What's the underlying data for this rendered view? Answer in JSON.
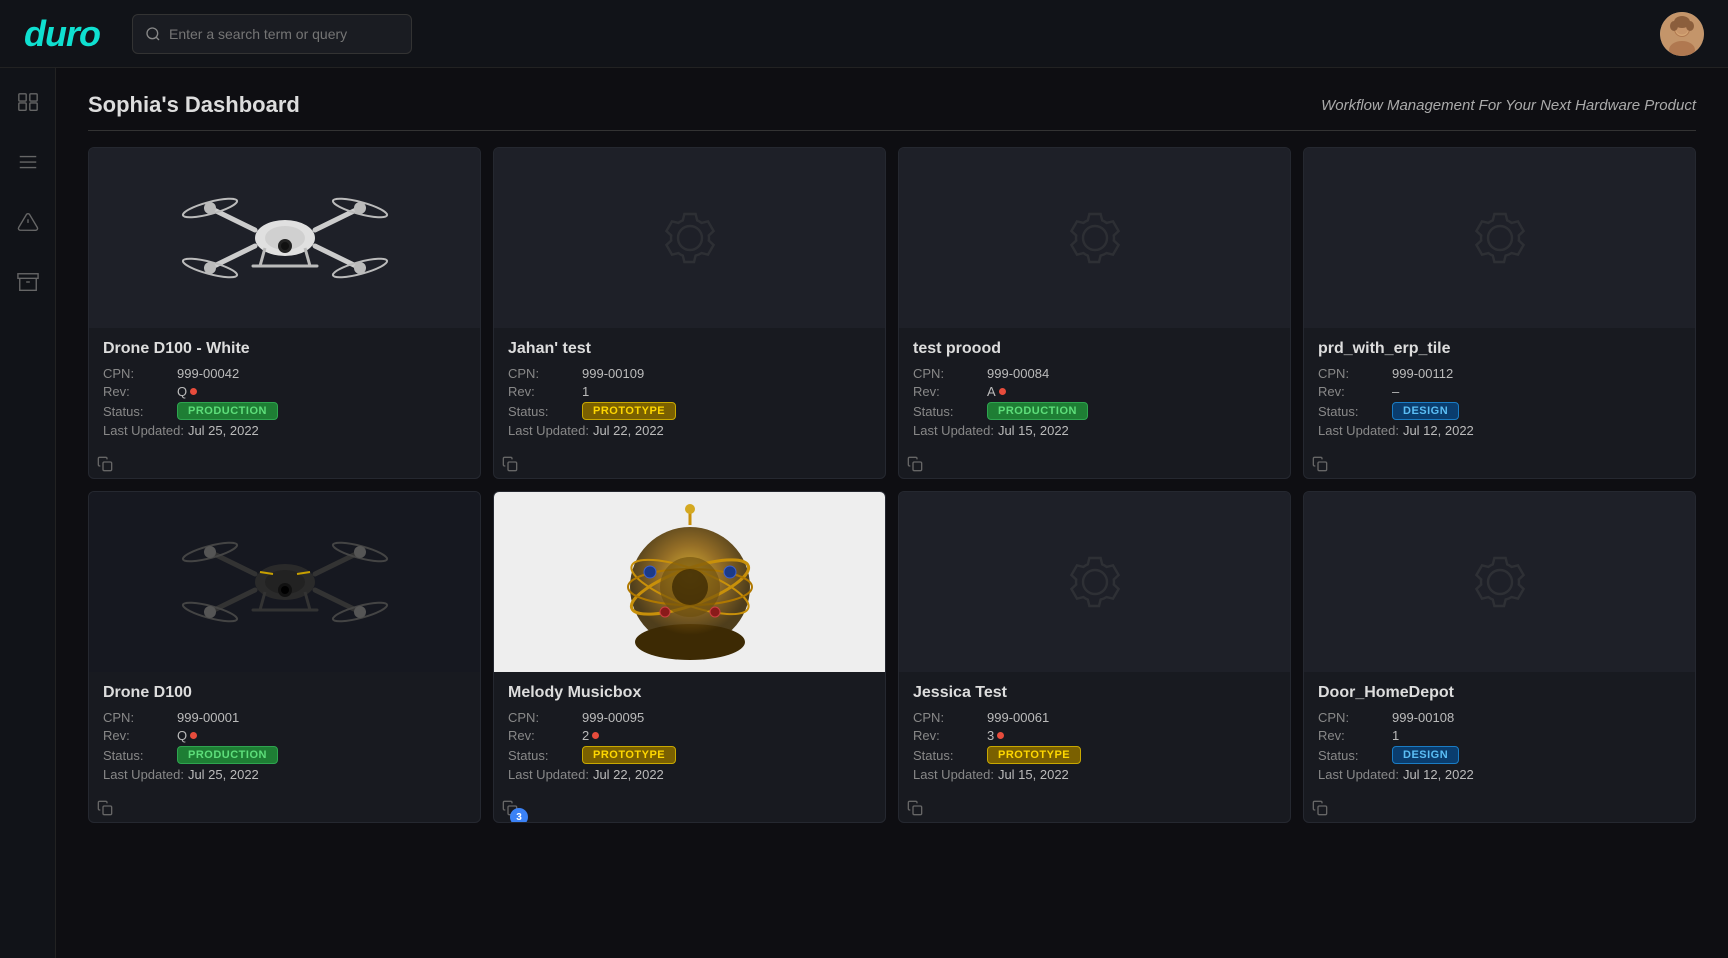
{
  "brand": {
    "logo": "duro"
  },
  "search": {
    "placeholder": "Enter a search term or query"
  },
  "header": {
    "dashboard_title": "Sophia's Dashboard",
    "dashboard_subtitle": "Workflow Management For Your Next Hardware Product"
  },
  "sidebar": {
    "icons": [
      {
        "name": "box-icon",
        "symbol": "⊞"
      },
      {
        "name": "list-icon",
        "symbol": "≡"
      },
      {
        "name": "warning-icon",
        "symbol": "△"
      },
      {
        "name": "archive-icon",
        "symbol": "⊟"
      }
    ]
  },
  "cards": [
    {
      "id": "card-1",
      "name": "Drone D100 - White",
      "cpn": "999-00042",
      "rev": "Q",
      "rev_dot": true,
      "status": "PRODUCTION",
      "status_type": "production",
      "last_updated": "Jul 25, 2022",
      "has_image": true,
      "image_type": "drone-white"
    },
    {
      "id": "card-2",
      "name": "Jahan' test",
      "cpn": "999-00109",
      "rev": "1",
      "rev_dot": false,
      "status": "PROTOTYPE",
      "status_type": "prototype",
      "last_updated": "Jul 22, 2022",
      "has_image": false,
      "image_type": "gear"
    },
    {
      "id": "card-3",
      "name": "test proood",
      "cpn": "999-00084",
      "rev": "A",
      "rev_dot": true,
      "status": "PRODUCTION",
      "status_type": "production",
      "last_updated": "Jul 15, 2022",
      "has_image": false,
      "image_type": "gear"
    },
    {
      "id": "card-4",
      "name": "prd_with_erp_tile",
      "cpn": "999-00112",
      "rev": "–",
      "rev_dot": false,
      "status": "DESIGN",
      "status_type": "design",
      "last_updated": "Jul 12, 2022",
      "has_image": false,
      "image_type": "gear"
    },
    {
      "id": "card-5",
      "name": "Drone D100",
      "cpn": "999-00001",
      "rev": "Q",
      "rev_dot": true,
      "status": "PRODUCTION",
      "status_type": "production",
      "last_updated": "Jul 25, 2022",
      "has_image": true,
      "image_type": "drone-dark"
    },
    {
      "id": "card-6",
      "name": "Melody Musicbox",
      "cpn": "999-00095",
      "rev": "2",
      "rev_dot": true,
      "status": "PROTOTYPE",
      "status_type": "prototype",
      "last_updated": "Jul 22, 2022",
      "has_image": true,
      "image_type": "musicbox",
      "notification_count": 3
    },
    {
      "id": "card-7",
      "name": "Jessica Test",
      "cpn": "999-00061",
      "rev": "3",
      "rev_dot": true,
      "status": "PROTOTYPE",
      "status_type": "prototype",
      "last_updated": "Jul 15, 2022",
      "has_image": false,
      "image_type": "gear"
    },
    {
      "id": "card-8",
      "name": "Door_HomeDepot",
      "cpn": "999-00108",
      "rev": "1",
      "rev_dot": false,
      "status": "DESIGN",
      "status_type": "design",
      "last_updated": "Jul 12, 2022",
      "has_image": false,
      "image_type": "gear"
    }
  ],
  "labels": {
    "cpn": "CPN:",
    "rev": "Rev:",
    "status": "Status:",
    "last_updated": "Last Updated:"
  }
}
